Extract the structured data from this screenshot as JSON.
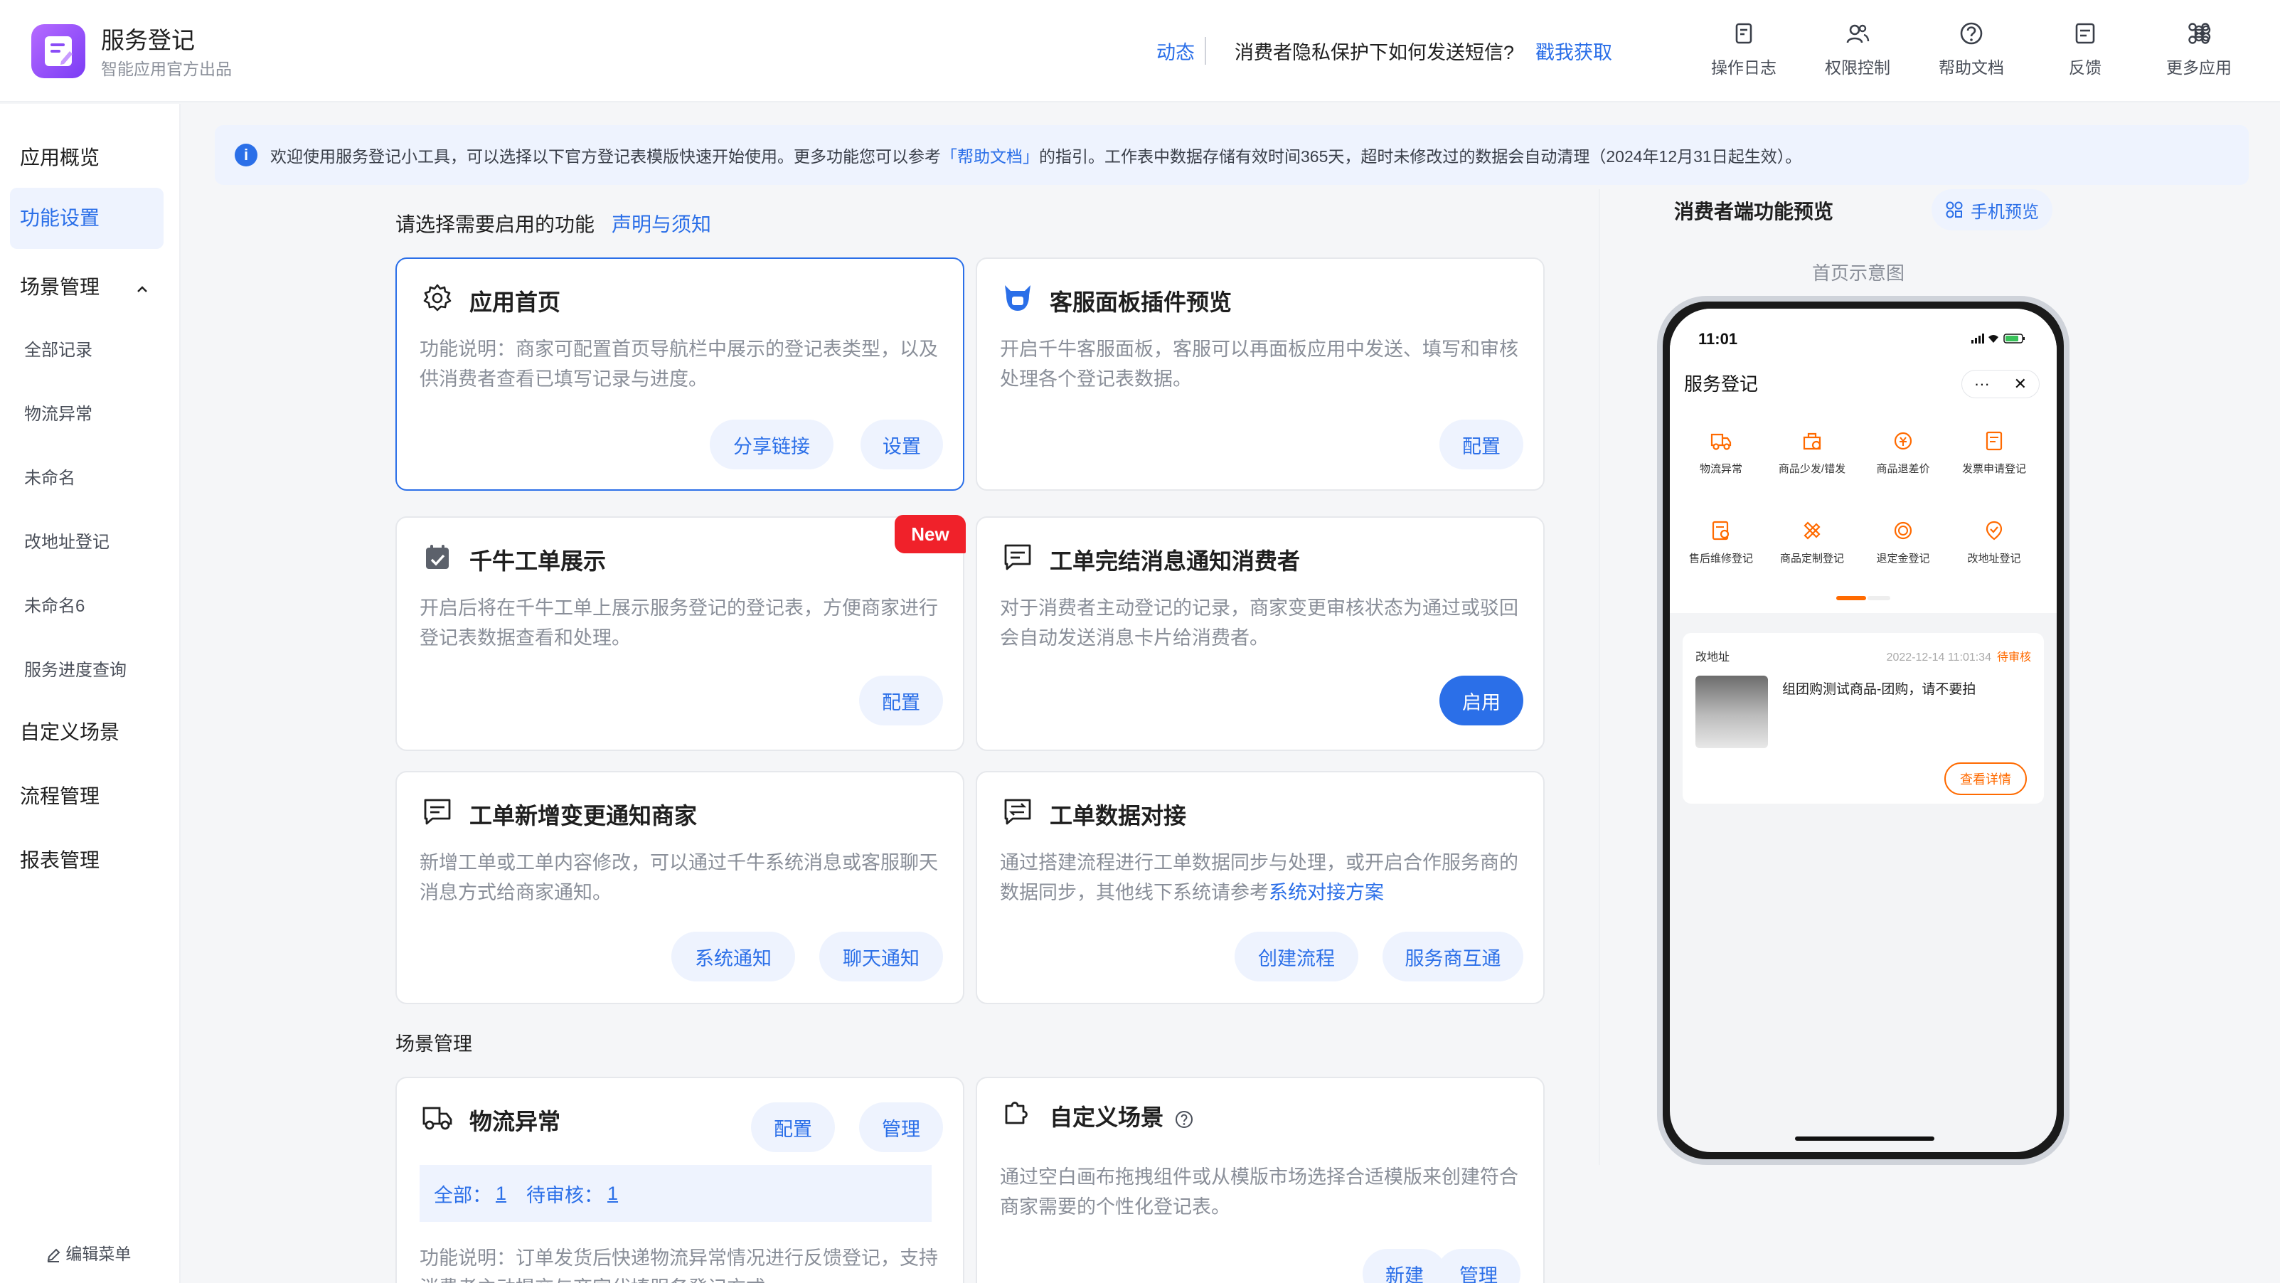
{
  "app": {
    "title": "服务登记",
    "subtitle": "智能应用官方出品"
  },
  "header": {
    "news_tag": "动态",
    "news_text": "消费者隐私保护下如何发送短信?",
    "news_link": "戳我获取",
    "tools": [
      {
        "label": "操作日志",
        "icon": "log-icon"
      },
      {
        "label": "权限控制",
        "icon": "permission-icon"
      },
      {
        "label": "帮助文档",
        "icon": "help-icon"
      },
      {
        "label": "反馈",
        "icon": "feedback-icon"
      },
      {
        "label": "更多应用",
        "icon": "more-apps-icon"
      }
    ]
  },
  "sidebar": {
    "items": [
      {
        "label": "应用概览"
      },
      {
        "label": "功能设置"
      },
      {
        "label": "场景管理"
      },
      {
        "label": "全部记录"
      },
      {
        "label": "物流异常"
      },
      {
        "label": "未命名"
      },
      {
        "label": "改地址登记"
      },
      {
        "label": "未命名6"
      },
      {
        "label": "服务进度查询"
      },
      {
        "label": "自定义场景"
      },
      {
        "label": "流程管理"
      },
      {
        "label": "报表管理"
      }
    ],
    "edit_menu": "编辑菜单"
  },
  "notice": {
    "text_before": "欢迎使用服务登记小工具，可以选择以下官方登记表模版快速开始使用。更多功能您可以参考",
    "link": "「帮助文档」",
    "text_after": "的指引。工作表中数据存储有效时间365天，超时未修改过的数据会自动清理（2024年12月31日起生效）。"
  },
  "features": {
    "title": "请选择需要启用的功能",
    "link": "声明与须知",
    "cards": [
      {
        "title": "应用首页",
        "desc": "功能说明：商家可配置首页导航栏中展示的登记表类型，以及供消费者查看已填写记录与进度。",
        "buttons": [
          "分享链接",
          "设置"
        ]
      },
      {
        "title": "客服面板插件预览",
        "desc": "开启千牛客服面板，客服可以再面板应用中发送、填写和审核处理各个登记表数据。",
        "buttons": [
          "配置"
        ]
      },
      {
        "title": "千牛工单展示",
        "badge": "New",
        "desc": "开启后将在千牛工单上展示服务登记的登记表，方便商家进行登记表数据查看和处理。",
        "buttons": [
          "配置"
        ]
      },
      {
        "title": "工单完结消息通知消费者",
        "desc": "对于消费者主动登记的记录，商家变更审核状态为通过或驳回会自动发送消息卡片给消费者。",
        "buttons": [
          "启用"
        ]
      },
      {
        "title": "工单新增变更通知商家",
        "desc": "新增工单或工单内容修改，可以通过千牛系统消息或客服聊天消息方式给商家通知。",
        "buttons": [
          "系统通知",
          "聊天通知"
        ]
      },
      {
        "title": "工单数据对接",
        "desc": "通过搭建流程进行工单数据同步与处理，或开启合作服务商的数据同步，其他线下系统请参考",
        "desc_link": "系统对接方案",
        "buttons": [
          "创建流程",
          "服务商互通"
        ]
      }
    ]
  },
  "scenes": {
    "title": "场景管理",
    "cards": [
      {
        "title": "物流异常",
        "buttons": [
          "配置",
          "管理"
        ],
        "stats_all_label": "全部：",
        "stats_all": "1",
        "stats_pending_label": "待审核：",
        "stats_pending": "1",
        "desc": "功能说明：订单发货后快递物流异常情况进行反馈登记，支持消费者主动提交与商家代填服务登记方式"
      },
      {
        "title": "自定义场景",
        "desc": "通过空白画布拖拽组件或从模版市场选择合适模版来创建符合商家需要的个性化登记表。",
        "buttons": [
          "新建",
          "管理"
        ]
      }
    ]
  },
  "preview": {
    "title": "消费者端功能预览",
    "phone_button": "手机预览",
    "home_label": "首页示意图",
    "phone": {
      "time": "11:01",
      "title": "服务登记",
      "grid": [
        {
          "label": "物流异常",
          "icon": "truck-icon"
        },
        {
          "label": "商品少发/错发",
          "icon": "package-icon"
        },
        {
          "label": "商品退差价",
          "icon": "price-refund-icon"
        },
        {
          "label": "发票申请登记",
          "icon": "invoice-icon"
        },
        {
          "label": "售后维修登记",
          "icon": "repair-icon"
        },
        {
          "label": "商品定制登记",
          "icon": "custom-icon"
        },
        {
          "label": "退定金登记",
          "icon": "deposit-icon"
        },
        {
          "label": "改地址登记",
          "icon": "address-icon"
        }
      ],
      "record": {
        "type": "改地址",
        "date": "2022-12-14 11:01:34",
        "status": "待审核",
        "text": "组团购测试商品-团购，请不要拍",
        "button": "查看详情"
      }
    }
  },
  "colors": {
    "accent": "#2b6fe8",
    "orange": "#ff6a00",
    "badge_red": "#f0212a"
  }
}
